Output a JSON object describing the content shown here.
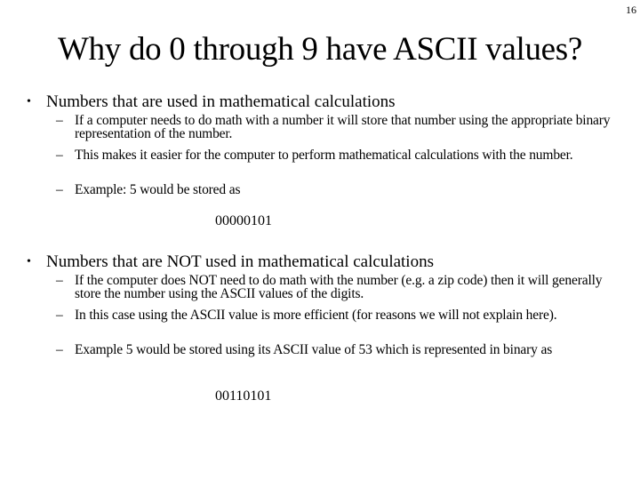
{
  "slide": {
    "number": "16",
    "title": "Why do 0 through 9 have ASCII values?"
  },
  "sections": [
    {
      "bullet": "Numbers that are used in mathematical calculations",
      "subitems": [
        "If a computer needs to do math with a number it will store that number using the appropriate binary representation of the number.",
        "This makes it easier for the computer to perform mathematical calculations with the number.",
        "Example:  5 would be stored as"
      ],
      "binary": "00000101"
    },
    {
      "bullet": "Numbers that are NOT used in mathematical calculations",
      "subitems": [
        "If the computer does NOT need to do math with the number (e.g. a zip code) then it will generally store the number using the ASCII values of the digits.",
        "In this case using the ASCII value is more efficient (for reasons we will not explain here).",
        "Example 5 would be stored using its ASCII value of 53 which is represented in binary as"
      ],
      "binary": "00110101"
    }
  ],
  "glyphs": {
    "bullet": "•",
    "dash": "–"
  }
}
